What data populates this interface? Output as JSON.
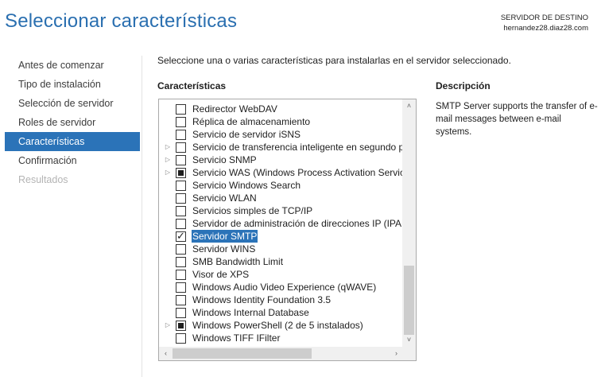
{
  "header": {
    "title": "Seleccionar características",
    "destination_label": "SERVIDOR DE DESTINO",
    "destination_server": "hernandez28.diaz28.com"
  },
  "nav": {
    "items": [
      {
        "label": "Antes de comenzar",
        "state": "normal"
      },
      {
        "label": "Tipo de instalación",
        "state": "normal"
      },
      {
        "label": "Selección de servidor",
        "state": "normal"
      },
      {
        "label": "Roles de servidor",
        "state": "normal"
      },
      {
        "label": "Características",
        "state": "active"
      },
      {
        "label": "Confirmación",
        "state": "normal"
      },
      {
        "label": "Resultados",
        "state": "disabled"
      }
    ]
  },
  "main": {
    "intro": "Seleccione una o varias características para instalarlas en el servidor seleccionado.",
    "features_heading": "Características",
    "features": [
      {
        "label": "Redirector WebDAV",
        "check": "unchecked",
        "expandable": false
      },
      {
        "label": "Réplica de almacenamiento",
        "check": "unchecked",
        "expandable": false
      },
      {
        "label": "Servicio de servidor iSNS",
        "check": "unchecked",
        "expandable": false
      },
      {
        "label": "Servicio de transferencia inteligente en segundo p",
        "check": "unchecked",
        "expandable": true
      },
      {
        "label": "Servicio SNMP",
        "check": "unchecked",
        "expandable": true
      },
      {
        "label": "Servicio WAS (Windows Process Activation Service",
        "check": "partial",
        "expandable": true
      },
      {
        "label": "Servicio Windows Search",
        "check": "unchecked",
        "expandable": false
      },
      {
        "label": "Servicio WLAN",
        "check": "unchecked",
        "expandable": false
      },
      {
        "label": "Servicios simples de TCP/IP",
        "check": "unchecked",
        "expandable": false
      },
      {
        "label": "Servidor de administración de direcciones IP (IPAM",
        "check": "unchecked",
        "expandable": false
      },
      {
        "label": "Servidor SMTP",
        "check": "checked",
        "expandable": false,
        "selected": true
      },
      {
        "label": "Servidor WINS",
        "check": "unchecked",
        "expandable": false
      },
      {
        "label": "SMB Bandwidth Limit",
        "check": "unchecked",
        "expandable": false
      },
      {
        "label": "Visor de XPS",
        "check": "unchecked",
        "expandable": false
      },
      {
        "label": "Windows Audio Video Experience (qWAVE)",
        "check": "unchecked",
        "expandable": false
      },
      {
        "label": "Windows Identity Foundation 3.5",
        "check": "unchecked",
        "expandable": false
      },
      {
        "label": "Windows Internal Database",
        "check": "unchecked",
        "expandable": false
      },
      {
        "label": "Windows PowerShell (2 de 5 instalados)",
        "check": "partial",
        "expandable": true
      },
      {
        "label": "Windows TIFF IFilter",
        "check": "unchecked",
        "expandable": false
      }
    ],
    "description_heading": "Descripción",
    "description_text": "SMTP Server supports the transfer of e-mail messages between e-mail systems."
  },
  "icons": {
    "expander": "chevron-right-icon",
    "scroll_up": "chevron-up-icon",
    "scroll_down": "chevron-down-icon",
    "scroll_left": "chevron-left-icon",
    "scroll_right": "chevron-right-icon"
  },
  "colors": {
    "title": "#2a6fb0",
    "accent": "#2b73b8",
    "disabled_text": "#b4b4b4"
  }
}
